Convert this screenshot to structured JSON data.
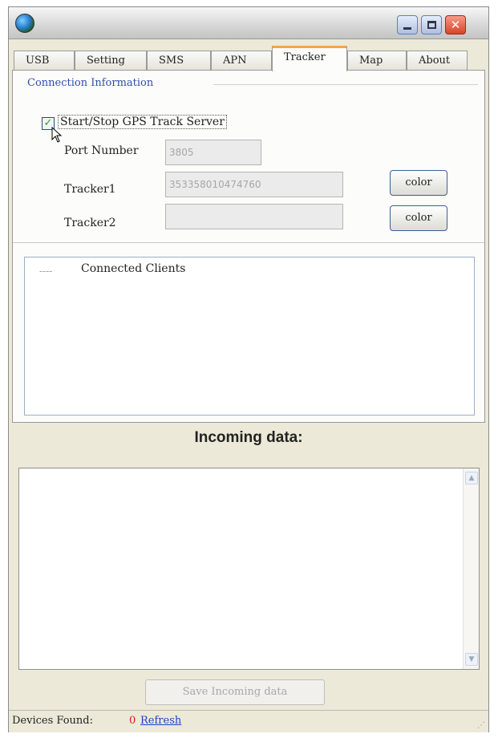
{
  "window": {
    "title": "",
    "icon": "globe-icon",
    "controls": {
      "minimize": "minimize-icon",
      "maximize": "maximize-icon",
      "close": "close-icon"
    }
  },
  "tabs": [
    {
      "label": "USB"
    },
    {
      "label": "Setting"
    },
    {
      "label": "SMS"
    },
    {
      "label": "APN"
    },
    {
      "label": "Tracker",
      "active": true
    },
    {
      "label": "Map"
    },
    {
      "label": "About"
    }
  ],
  "connection": {
    "group_title": "Connection Information",
    "server_checkbox_label": "Start/Stop GPS Track Server",
    "server_checked": true,
    "port_label": "Port Number",
    "port_value": "3805",
    "tracker1_label": "Tracker1",
    "tracker1_value": "353358010474760",
    "tracker2_label": "Tracker2",
    "tracker2_value": "",
    "color_button_label": "color"
  },
  "clients": {
    "label": "Connected Clients",
    "tree_prefix": "----"
  },
  "incoming": {
    "title": "Incoming data:",
    "content": "",
    "save_button_label": "Save Incoming data"
  },
  "status": {
    "label": "Devices Found:",
    "count": "0",
    "refresh_label": "Refresh"
  },
  "colors": {
    "accent_tab": "#f0a742",
    "group_title": "#2f4fa8",
    "count": "#d21d1d",
    "link": "#1b43c7"
  }
}
